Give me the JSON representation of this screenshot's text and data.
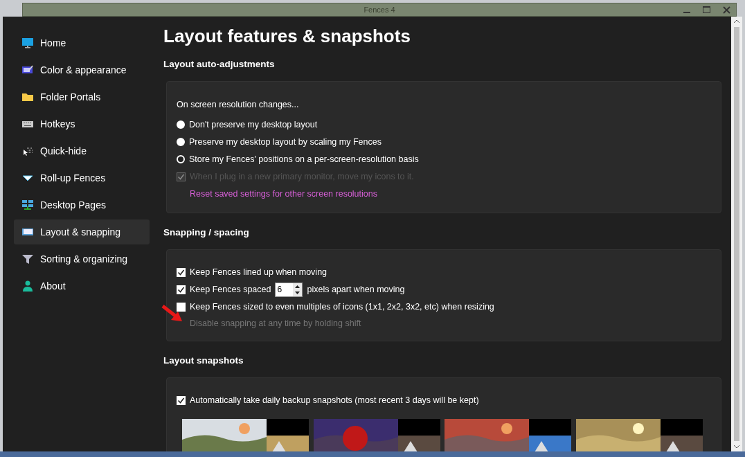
{
  "window": {
    "title": "Fences 4"
  },
  "sidebar": {
    "items": [
      {
        "label": "Home",
        "selected": false
      },
      {
        "label": "Color & appearance",
        "selected": false
      },
      {
        "label": "Folder Portals",
        "selected": false
      },
      {
        "label": "Hotkeys",
        "selected": false
      },
      {
        "label": "Quick-hide",
        "selected": false
      },
      {
        "label": "Roll-up Fences",
        "selected": false
      },
      {
        "label": "Desktop Pages",
        "selected": false
      },
      {
        "label": "Layout & snapping",
        "selected": true
      },
      {
        "label": "Sorting & organizing",
        "selected": false
      },
      {
        "label": "About",
        "selected": false
      }
    ]
  },
  "page_title": "Layout features & snapshots",
  "sections": [
    {
      "title": "Layout auto-adjustments",
      "rows": [
        {
          "kind": "label",
          "text": "On screen resolution changes..."
        },
        {
          "kind": "radio",
          "text": "Don't preserve my desktop layout",
          "selected": false
        },
        {
          "kind": "radio",
          "text": "Preserve my desktop layout by scaling my Fences",
          "selected": false
        },
        {
          "kind": "radio",
          "text": "Store my Fences' positions on a per-screen-resolution basis",
          "selected": true
        },
        {
          "kind": "checkbox",
          "text": "When I plug in a new primary monitor, move my icons to it.",
          "checked": true,
          "disabled": true
        },
        {
          "kind": "link",
          "text": "Reset saved settings for other screen resolutions"
        }
      ]
    },
    {
      "title": "Snapping / spacing",
      "rows": [
        {
          "kind": "checkbox",
          "text": "Keep Fences lined up when moving",
          "checked": true,
          "disabled": false
        },
        {
          "kind": "spin",
          "text": "Keep Fences spaced",
          "value": "6",
          "after": "pixels apart when moving",
          "checked": true,
          "disabled": false
        },
        {
          "kind": "checkbox",
          "text": "Keep Fences sized to even multiples of icons (1x1, 2x2, 3x2, etc) when resizing",
          "checked": false,
          "disabled": false
        },
        {
          "kind": "hint",
          "text": "Disable snapping at any time by holding shift"
        }
      ]
    },
    {
      "title": "Layout snapshots",
      "rows": [
        {
          "kind": "checkbox",
          "text": "Automatically take daily backup snapshots (most recent 3 days will be kept)",
          "checked": true,
          "disabled": false
        },
        {
          "kind": "snapshots"
        }
      ]
    }
  ]
}
